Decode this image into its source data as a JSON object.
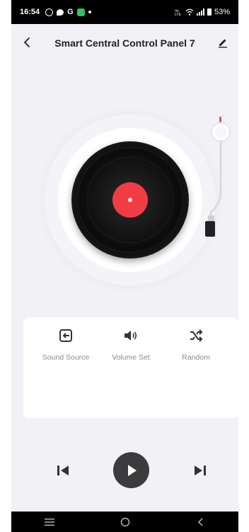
{
  "status_bar": {
    "time": "16:54",
    "battery": "53%",
    "network_text": "Vo LTE"
  },
  "header": {
    "title": "Smart Central Control Panel 7"
  },
  "controls": [
    {
      "label": "Sound Source",
      "icon": "sound-source-icon"
    },
    {
      "label": "Volume Set",
      "icon": "volume-icon"
    },
    {
      "label": "Random",
      "icon": "shuffle-icon"
    }
  ],
  "colors": {
    "background": "#f1f1f6",
    "record_label": "#f23c44",
    "play_button": "#3c3c3e",
    "text_primary": "#222222",
    "text_secondary": "#8a8a8e"
  }
}
